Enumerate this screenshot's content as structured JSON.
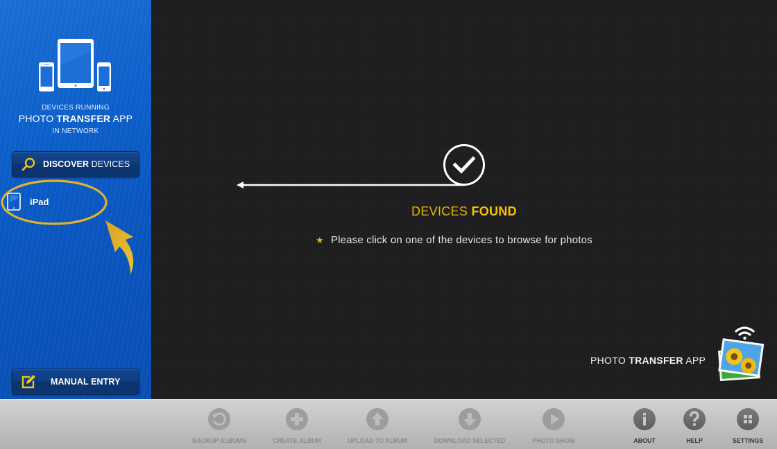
{
  "sidebar": {
    "heading": {
      "line1": "DEVICES RUNNING",
      "line2_regular_a": "PHOTO ",
      "line2_bold": "TRANSFER",
      "line2_regular_b": " APP",
      "line3": "IN NETWORK"
    },
    "discover_button": {
      "label_bold": "DISCOVER",
      "label_regular": " DEVICES",
      "icon": "search-icon"
    },
    "devices": [
      {
        "name": "iPad",
        "icon": "tablet-icon",
        "highlighted": true
      }
    ],
    "manual_entry_button": {
      "label": "MANUAL ENTRY",
      "icon": "edit-icon"
    }
  },
  "main": {
    "status_icon": "checkmark-circle-icon",
    "title_regular": "DEVICES ",
    "title_bold": "FOUND",
    "hint_icon": "star-icon",
    "hint_text": "Please click on one of the devices to browse for photos",
    "brand": {
      "regular_a": "PHOTO ",
      "bold": "TRANSFER",
      "regular_b": " APP"
    }
  },
  "toolbar": {
    "items": [
      {
        "label": "BACKUP ALBUMS",
        "icon": "backup-icon",
        "enabled": false
      },
      {
        "label": "CREATE ALBUM",
        "icon": "plus-icon",
        "enabled": false
      },
      {
        "label": "UPLOAD TO ALBUM",
        "icon": "upload-arrow-icon",
        "enabled": false
      },
      {
        "label": "DOWNLOAD SELECTED",
        "icon": "download-arrow-icon",
        "enabled": false
      },
      {
        "label": "PHOTO SHOW",
        "icon": "play-icon",
        "enabled": false
      },
      {
        "label": "ABOUT",
        "icon": "info-icon",
        "enabled": true
      },
      {
        "label": "HELP",
        "icon": "question-icon",
        "enabled": true
      },
      {
        "label": "SETTINGS",
        "icon": "grid-icon",
        "enabled": true
      }
    ]
  },
  "colors": {
    "sidebar_blue": "#0c5fcc",
    "accent_yellow": "#e6b800",
    "main_bg": "#1f1f21",
    "toolbar_bg": "#c3c3c5"
  }
}
